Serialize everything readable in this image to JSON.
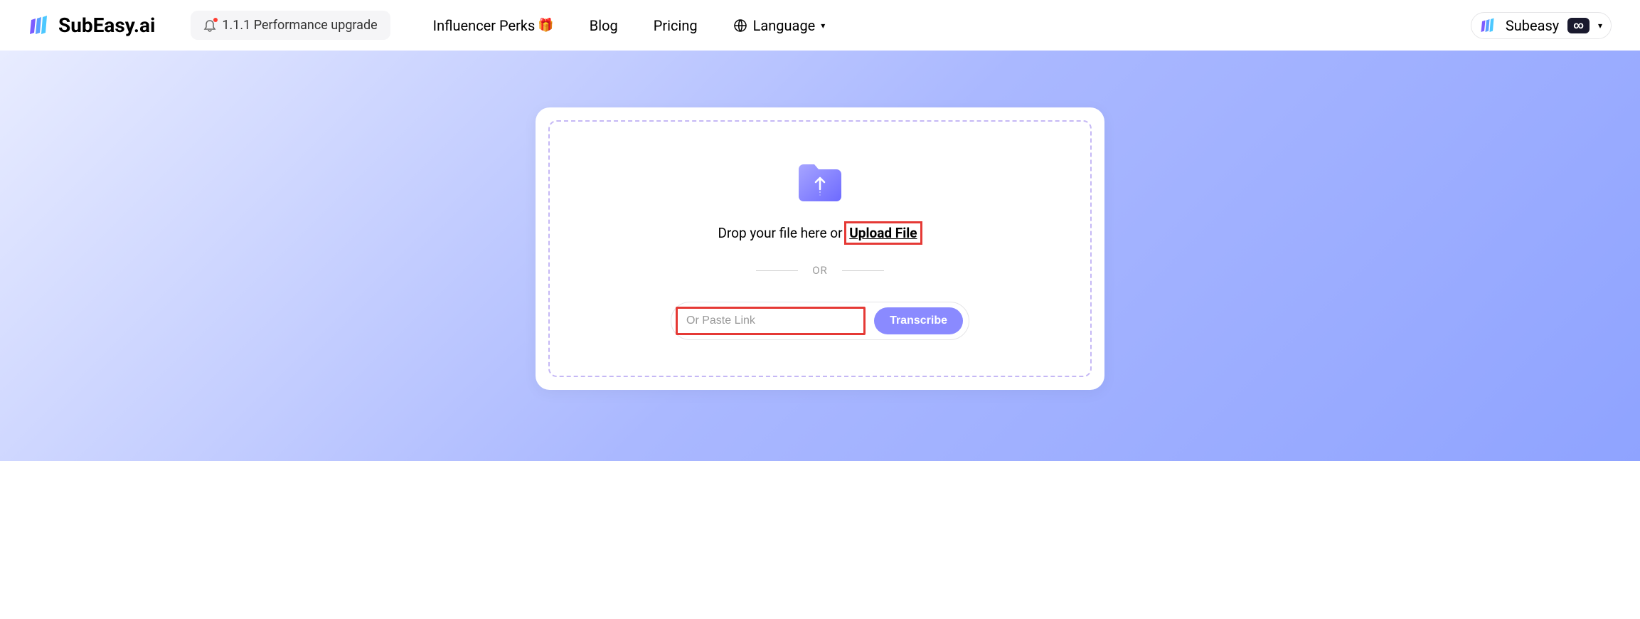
{
  "header": {
    "brand": "SubEasy.ai",
    "upgrade_label": "1.1.1 Performance upgrade",
    "nav": {
      "influencer": "Influencer Perks",
      "blog": "Blog",
      "pricing": "Pricing",
      "language": "Language"
    },
    "user": {
      "name": "Subeasy",
      "infinity": "∞"
    }
  },
  "upload": {
    "drop_prefix": "Drop your file here or ",
    "upload_link": "Upload File",
    "divider": "OR",
    "link_placeholder": "Or Paste Link",
    "transcribe_label": "Transcribe"
  }
}
